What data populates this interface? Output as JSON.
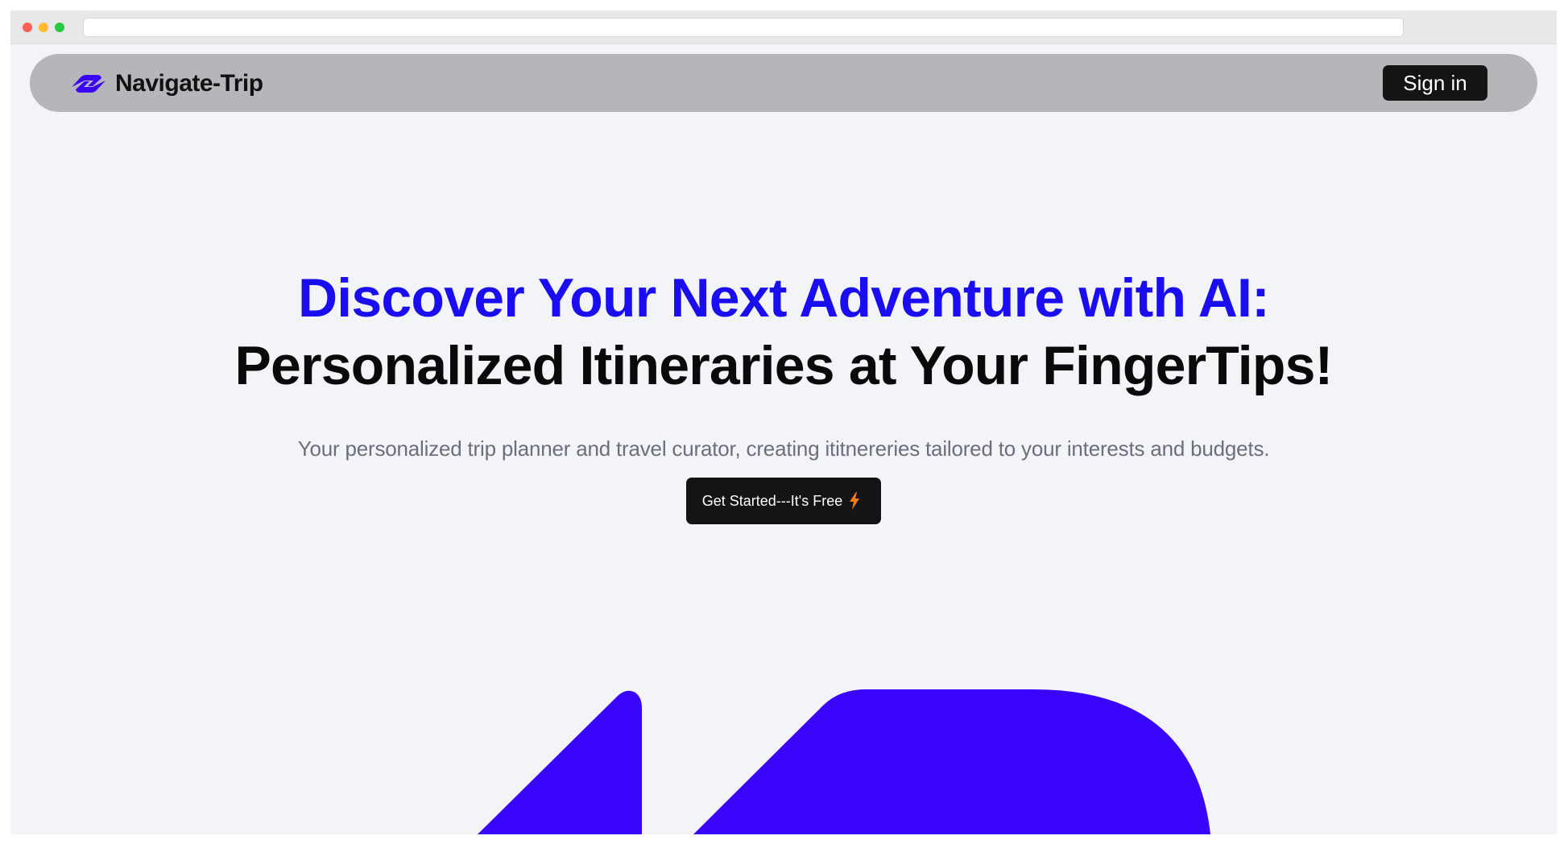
{
  "browser": {
    "controls": [
      "close",
      "minimize",
      "maximize"
    ]
  },
  "navbar": {
    "brand_name": "Navigate-Trip",
    "brand_icon": "navigate-trip-logo-icon",
    "signin_label": "Sign in"
  },
  "hero": {
    "headline_line1": "Discover Your Next Adventure with AI:",
    "headline_line2": "Personalized Itineraries at Your FingerTips!",
    "subtitle": "Your personalized trip planner and travel curator, creating ititnereries tailored to your interests and budgets.",
    "cta_label": "Get Started---It's Free",
    "cta_icon": "lightning-bolt-icon"
  },
  "colors": {
    "accent": "#1a0ef0",
    "art": "#3a05fb",
    "nav_bg": "#b5b6ba",
    "page_bg": "#f3f4f8",
    "button_bg": "#141414",
    "bolt": "#ff7a1a"
  }
}
